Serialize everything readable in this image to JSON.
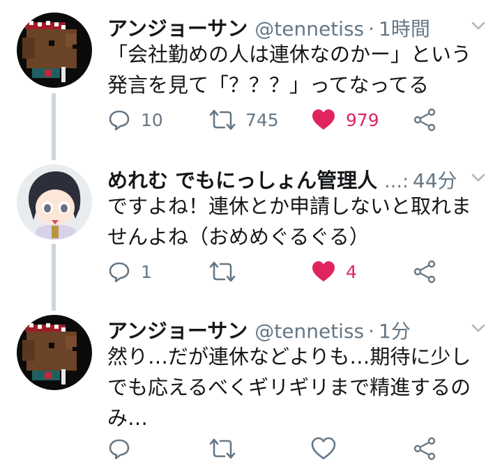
{
  "tweets": [
    {
      "name": "アンジョーサン",
      "handle": "@tennetiss",
      "time": "1時間",
      "lines": [
        "「会社勤めの人は連休なのかー」という",
        "発言を見て「？？？」ってなってる"
      ],
      "reply": "10",
      "retweet": "745",
      "like": "979",
      "liked": true
    },
    {
      "name": "めれむ でもにっしょん管理人",
      "ellipsis": "…:",
      "time": "44分",
      "lines": [
        "ですよね！連休とか申請しないと取れま",
        "せんよね（おめめぐるぐる）"
      ],
      "reply": "1",
      "retweet": "",
      "like": "4",
      "liked": true
    },
    {
      "name": "アンジョーサン",
      "handle": "@tennetiss",
      "time": "1分",
      "lines": [
        "然り…だが連休などよりも…期待に少し",
        "でも応えるべくギリギリまで精進するの",
        "み…"
      ],
      "reply": "",
      "retweet": "",
      "like": "",
      "liked": false
    }
  ],
  "separator": "·",
  "colors": {
    "like_active": "#e0245e",
    "icon_gray": "#657786",
    "thread_line": "#ccd6dd"
  },
  "icons": [
    "reply-icon",
    "retweet-icon",
    "like-icon",
    "share-icon",
    "chevron-down-icon"
  ]
}
